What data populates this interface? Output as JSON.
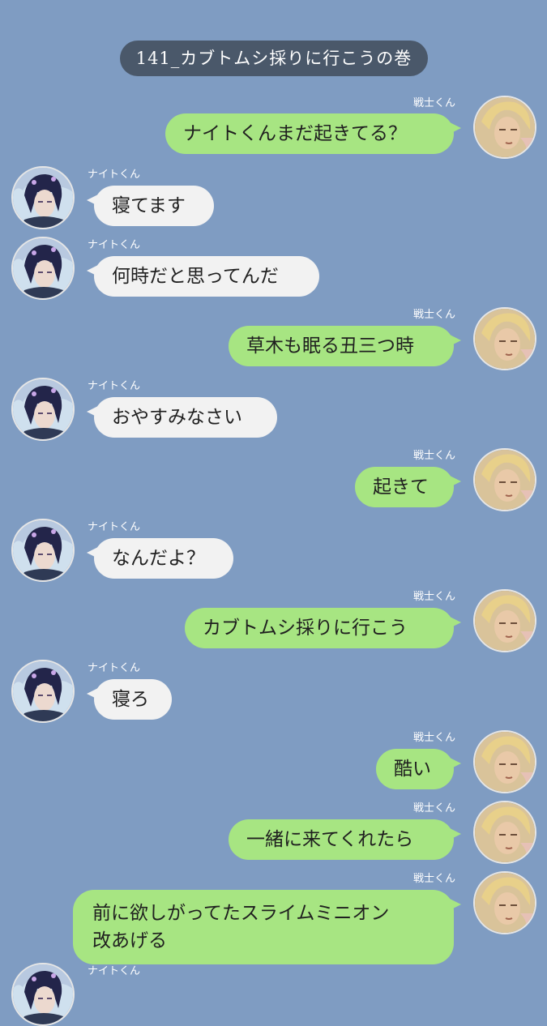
{
  "chat_title": "141_カブトムシ採りに行こうの巻",
  "names": {
    "warrior": "戦士くん",
    "knight": "ナイトくん"
  },
  "messages": [
    {
      "sender": "warrior",
      "text": "ナイトくんまだ起きてる？"
    },
    {
      "sender": "knight",
      "text": "寝てます"
    },
    {
      "sender": "knight",
      "text": "何時だと思ってんだ"
    },
    {
      "sender": "warrior",
      "text": "草木も眠る丑三つ時"
    },
    {
      "sender": "knight",
      "text": "おやすみなさい"
    },
    {
      "sender": "warrior",
      "text": "起きて"
    },
    {
      "sender": "knight",
      "text": "なんだよ？"
    },
    {
      "sender": "warrior",
      "text": "カブトムシ採りに行こう"
    },
    {
      "sender": "knight",
      "text": "寝ろ"
    },
    {
      "sender": "warrior",
      "text": "酷い"
    },
    {
      "sender": "warrior",
      "text": "一緒に来てくれたら"
    },
    {
      "sender": "warrior",
      "lines": [
        "前に欲しがってたスライムミニオン",
        "改あげる"
      ]
    },
    {
      "sender": "knight",
      "text": ""
    }
  ],
  "colors": {
    "background": "#7f9cc2",
    "title_pill": "#4a586a",
    "bubble_left": "#f2f2f2",
    "bubble_right": "#a7e582"
  },
  "avatars": {
    "warrior": "blond-warrior-avatar",
    "knight": "dark-knight-avatar"
  }
}
